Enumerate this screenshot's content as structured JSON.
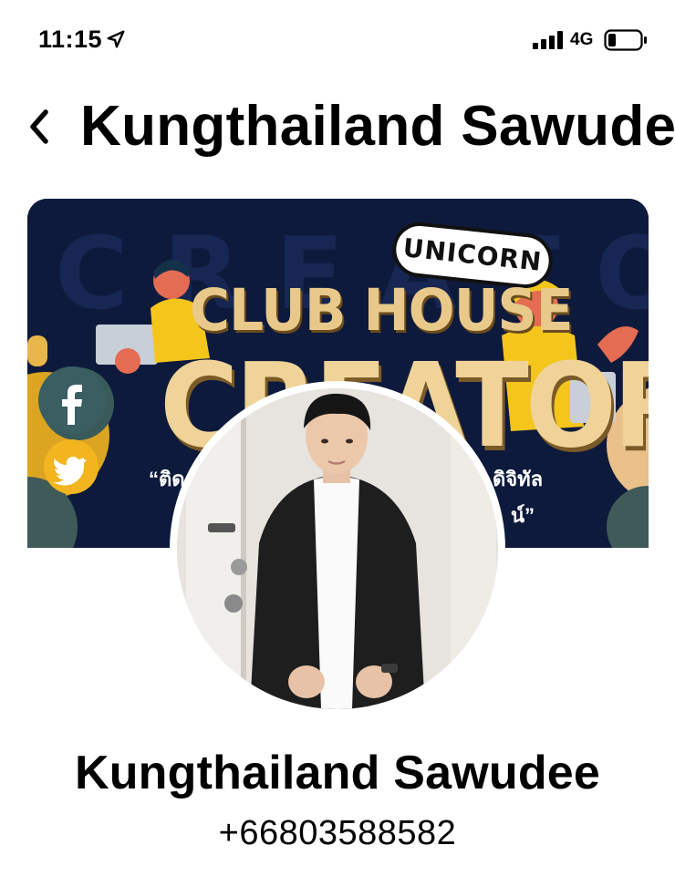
{
  "status_bar": {
    "time": "11:15",
    "network": "4G",
    "icons": [
      "location-arrow-icon",
      "cellular-signal-icon",
      "battery-icon"
    ]
  },
  "header": {
    "title": "Kungthailand Sawudee",
    "back_icon": "chevron-left-icon"
  },
  "cover": {
    "badge": "UNICORN",
    "title_line_1": "CLUB HOUSE",
    "title_line_2": "CREATOR",
    "caption_left": "“ติด",
    "caption_right": "ดิจิทัล",
    "caption_right_2": "น์”",
    "icons": [
      "facebook-icon",
      "twitter-icon"
    ]
  },
  "profile": {
    "name": "Kungthailand Sawudee",
    "phone": "+66803588582"
  },
  "colors": {
    "cover_background": "#0e1a3c",
    "cover_title": "#f0d398",
    "facebook": "#2f4e9c",
    "twitter": "#f2b51f"
  }
}
